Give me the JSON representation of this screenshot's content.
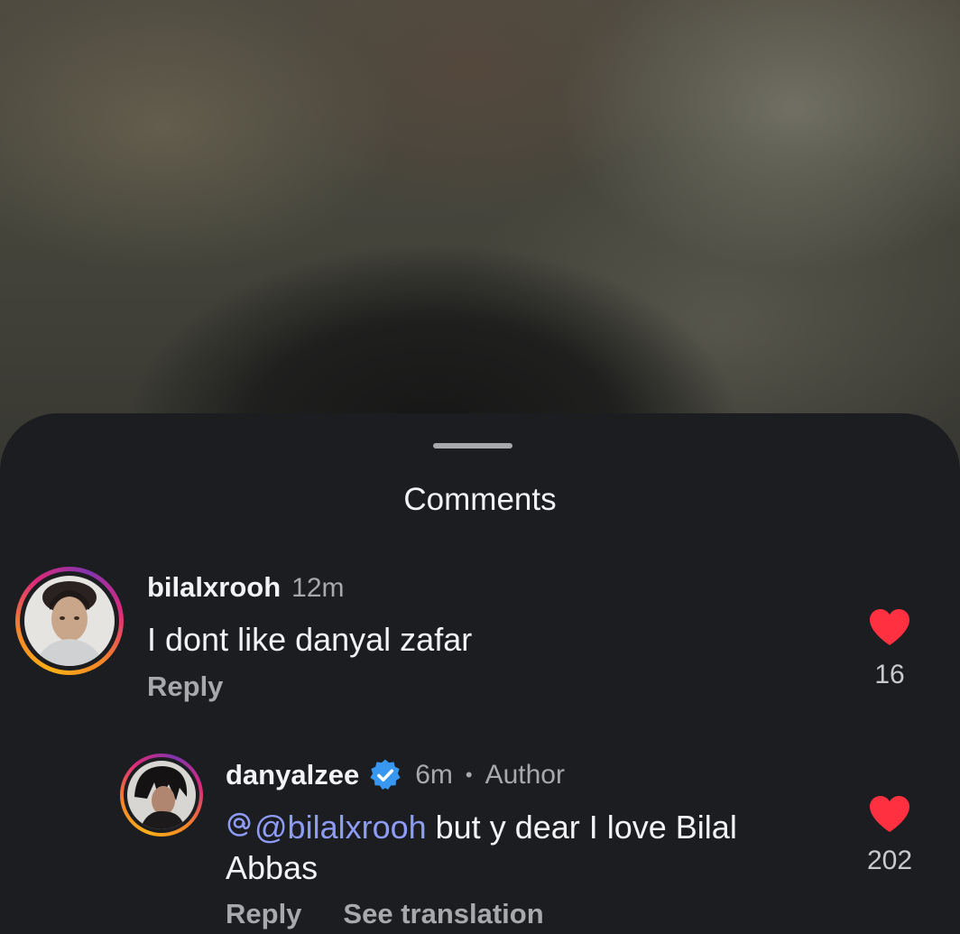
{
  "sheet": {
    "title": "Comments"
  },
  "comments": [
    {
      "username": "bilalxrooh",
      "time": "12m",
      "text": "I dont like danyal zafar",
      "reply_label": "Reply",
      "likes": "16"
    }
  ],
  "replies": [
    {
      "username": "danyalzee",
      "verified": true,
      "time": "6m",
      "separator": "•",
      "role": "Author",
      "mention": "@bilalxrooh",
      "text_line1": " but y dear I love Bilal",
      "text_line2": "Abbas",
      "reply_label": "Reply",
      "translate_label": "See translation",
      "likes": "202"
    }
  ],
  "colors": {
    "sheet_bg": "#1b1d20",
    "heart": "#ff3040",
    "mention": "#8e9cf6",
    "verified": "#3897f0"
  },
  "icons": [
    "heart-icon",
    "verified-badge-icon",
    "threads-at-icon"
  ]
}
